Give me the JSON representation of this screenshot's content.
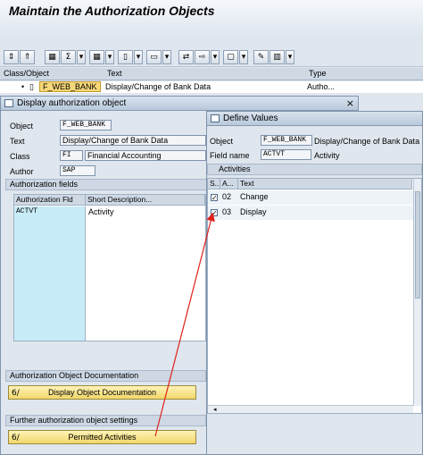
{
  "title": "Maintain the Authorization Objects",
  "tree_header": {
    "col1": "Class/Object",
    "col2": "Text",
    "col3": "Type"
  },
  "tree_row": {
    "bullet": "•",
    "object": "F_WEB_BANK",
    "text": "Display/Change of Bank Data",
    "type": "Autho..."
  },
  "toolbar_icons": [
    "⇕",
    "⇑",
    "▦",
    "Σ",
    "▾",
    "▦",
    "▾",
    "▯",
    "▾",
    "▭",
    "▾",
    "⇄",
    "⇨",
    "▾",
    "▢",
    "▾",
    "✎",
    "▥",
    "▾"
  ],
  "win1": {
    "title": "Display authorization object",
    "close": "×",
    "fields": {
      "object_label": "Object",
      "object_value": "F_WEB_BANK",
      "text_label": "Text",
      "text_value": "Display/Change of Bank Data",
      "class_label": "Class",
      "class_value": "FI",
      "class_desc": "Financial Accounting",
      "author_label": "Author",
      "author_value": "SAP"
    },
    "auth_fields_title": "Authorization fields",
    "auth_table": {
      "col1": "Authorization Fld",
      "col2": "Short Description...",
      "rows": [
        {
          "fld": "ACTVT",
          "desc": "Activity"
        }
      ]
    },
    "doc_group": "Authorization Object Documentation",
    "doc_button": "Display Object Documentation",
    "further_group": "Further authorization object settings",
    "permitted_button": "Permitted Activities",
    "button_icon": "6∕"
  },
  "win2": {
    "title": "Define Values",
    "object_label": "Object",
    "object_value": "F_WEB_BANK",
    "object_desc": "Display/Change of Bank Data",
    "fieldname_label": "Field name",
    "fieldname_value": "ACTVT",
    "fieldname_desc": "Activity",
    "activities_title": "Activities",
    "table": {
      "col1": "S..",
      "col2": "A...",
      "col3": "Text",
      "rows": [
        {
          "checked": true,
          "code": "02",
          "text": "Change"
        },
        {
          "checked": true,
          "code": "03",
          "text": "Display"
        }
      ]
    },
    "check_glyph": "✓"
  },
  "colors": {
    "highlight": "#f7d879",
    "arrow": "#e0211c",
    "column_blue": "#c8ecf7"
  }
}
